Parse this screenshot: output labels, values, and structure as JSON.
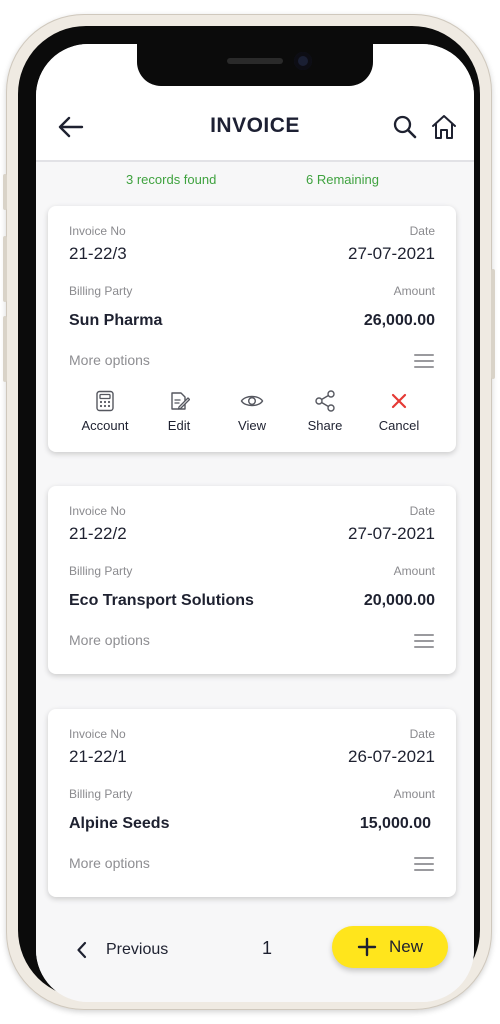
{
  "header": {
    "title": "INVOICE"
  },
  "status": {
    "records": "3 records found",
    "remaining": "6 Remaining"
  },
  "labels": {
    "invoice_no": "Invoice No",
    "date": "Date",
    "billing_party": "Billing Party",
    "amount": "Amount",
    "more_options": "More options"
  },
  "invoices": [
    {
      "invoice_no": "21-22/3",
      "date": "27-07-2021",
      "party": "Sun Pharma",
      "amount": "26,000.00"
    },
    {
      "invoice_no": "21-22/2",
      "date": "27-07-2021",
      "party": "Eco Transport Solutions",
      "amount": "20,000.00"
    },
    {
      "invoice_no": "21-22/1",
      "date": "26-07-2021",
      "party": "Alpine Seeds",
      "amount": "15,000.00"
    }
  ],
  "actions": [
    {
      "label": "Account",
      "icon": "calculator-icon"
    },
    {
      "label": "Edit",
      "icon": "edit-icon"
    },
    {
      "label": "View",
      "icon": "eye-icon"
    },
    {
      "label": "Share",
      "icon": "share-icon"
    },
    {
      "label": "Cancel",
      "icon": "close-icon"
    }
  ],
  "pagination": {
    "previous": "Previous",
    "page": "1"
  },
  "fab": {
    "label": "New"
  },
  "colors": {
    "accent_yellow": "#ffe51c",
    "status_green": "#3fa23f",
    "cancel_red": "#e53935",
    "text_dark": "#1e2130"
  }
}
